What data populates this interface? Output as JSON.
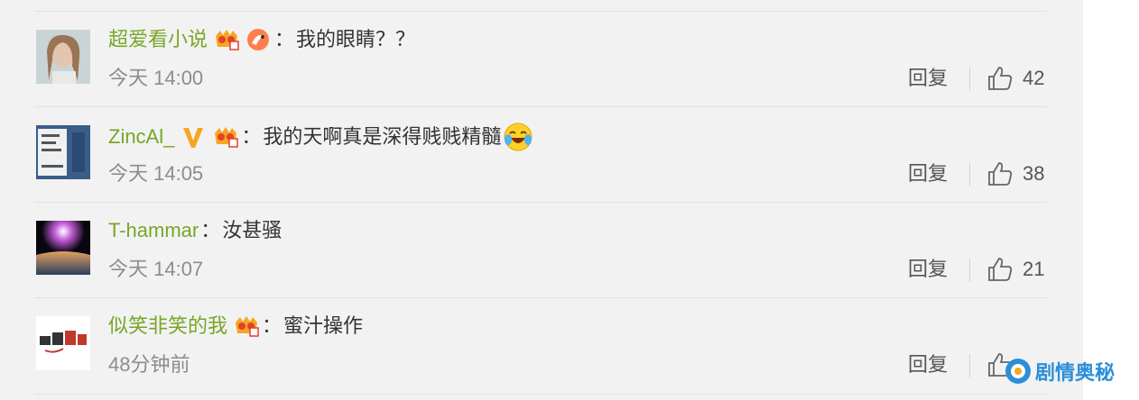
{
  "comments": [
    {
      "username": "超爱看小说",
      "colon": "：",
      "text": "我的眼睛？？",
      "time": "今天 14:00",
      "reply": "回复",
      "likes": "42",
      "badges": [
        "crown-vip-icon",
        "fox-badge-icon"
      ]
    },
    {
      "username": "ZincAl_",
      "colon": "：",
      "text": "我的天啊真是深得贱贱精髓",
      "time": "今天 14:05",
      "reply": "回复",
      "likes": "38",
      "badges": [
        "verified-v-icon",
        "crown-vip-icon",
        "laughing-cry-emoji"
      ]
    },
    {
      "username": "T-hammar",
      "colon": "：",
      "text": "汝甚骚",
      "time": "今天 14:07",
      "reply": "回复",
      "likes": "21",
      "badges": []
    },
    {
      "username": "似笑非笑的我",
      "colon": "：",
      "text": "蜜汁操作",
      "time": "48分钟前",
      "reply": "回复",
      "likes": "",
      "badges": [
        "crown-vip-icon"
      ]
    }
  ],
  "watermark": {
    "text": "剧情奥秘"
  },
  "colors": {
    "username": "#78a626",
    "text": "#333333",
    "meta": "#8c8c8c",
    "accent": "#2b8fd8"
  }
}
